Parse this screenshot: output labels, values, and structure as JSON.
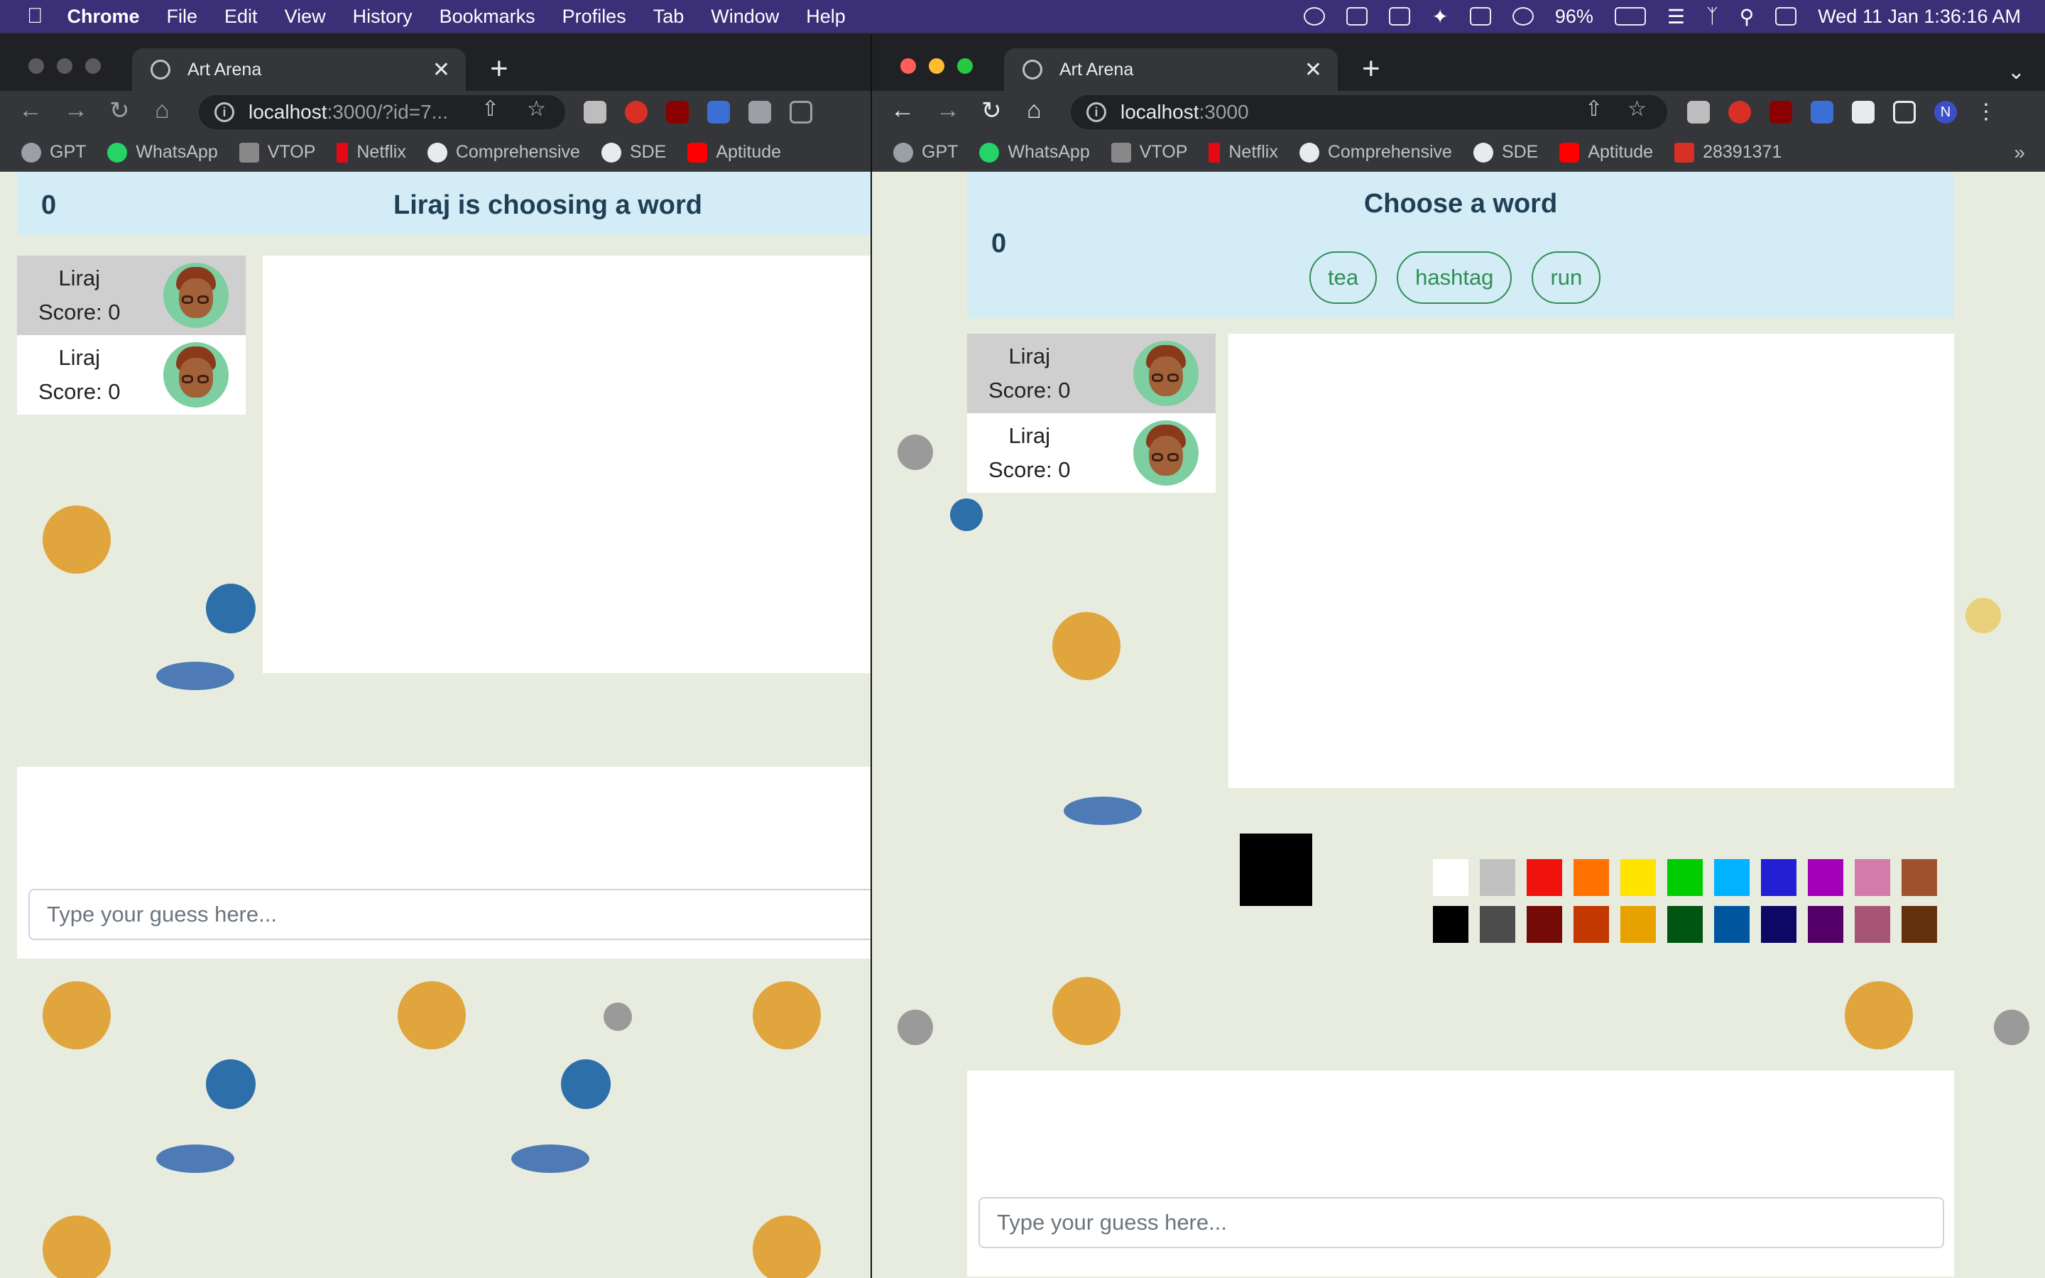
{
  "menubar": {
    "app": "Chrome",
    "items": [
      "File",
      "Edit",
      "View",
      "History",
      "Bookmarks",
      "Profiles",
      "Tab",
      "Window",
      "Help"
    ],
    "battery": "96%",
    "datetime": "Wed 11 Jan  1:36:16 AM"
  },
  "left_window": {
    "tab_title": "Art Arena",
    "url_host": "localhost",
    "url_rest": ":3000/?id=7...",
    "bookmarks": [
      "GPT",
      "WhatsApp",
      "VTOP",
      "Netflix",
      "Comprehensive",
      "SDE",
      "Aptitude"
    ],
    "game": {
      "round_number": "0",
      "status": "Liraj is choosing a word",
      "players": [
        {
          "name": "Liraj",
          "score": "Score: 0"
        },
        {
          "name": "Liraj",
          "score": "Score: 0"
        }
      ],
      "guess_placeholder": "Type your guess here..."
    }
  },
  "right_window": {
    "tab_title": "Art Arena",
    "url_host": "localhost",
    "url_rest": ":3000",
    "profile_initial": "N",
    "bookmarks": [
      "GPT",
      "WhatsApp",
      "VTOP",
      "Netflix",
      "Comprehensive",
      "SDE",
      "Aptitude",
      "28391371"
    ],
    "game": {
      "round_number": "0",
      "status": "Choose a word",
      "word_choices": [
        "tea",
        "hashtag",
        "run"
      ],
      "players": [
        {
          "name": "Liraj",
          "score": "Score: 0"
        },
        {
          "name": "Liraj",
          "score": "Score: 0"
        }
      ],
      "selected_color": "#000000",
      "palette_row1": [
        "#ffffff",
        "#c1c1c1",
        "#ef130b",
        "#ff7100",
        "#ffe400",
        "#00cc00",
        "#00b2ff",
        "#231fd3",
        "#a300ba",
        "#d37caa",
        "#a0522d"
      ],
      "palette_row2": [
        "#000000",
        "#4c4c4c",
        "#740b07",
        "#c23800",
        "#e8a200",
        "#005510",
        "#00569e",
        "#0e0865",
        "#550069",
        "#a75574",
        "#63300d"
      ],
      "brush_sizes": [
        "small",
        "medium",
        "large",
        "xlarge"
      ],
      "clear_button": "clear-canvas",
      "guess_placeholder": "Type your guess here..."
    }
  }
}
